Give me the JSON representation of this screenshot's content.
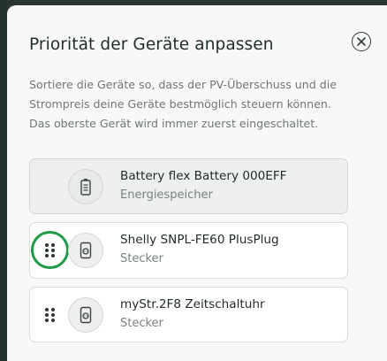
{
  "dialog": {
    "title": "Priorität der Geräte anpassen",
    "description": "Sortiere die Geräte so, dass der PV-Überschuss und die Strompreis deine Geräte bestmöglich steuern können. Das oberste Gerät wird immer zuerst eingeschaltet.",
    "close_icon": "close-circle-icon"
  },
  "devices": [
    {
      "name": "Battery flex Battery 000EFF",
      "type": "Energiespeicher",
      "icon": "battery-icon",
      "draggable": false
    },
    {
      "name": "Shelly SNPL-FE60 PlusPlug",
      "type": "Stecker",
      "icon": "smart-plug-icon",
      "draggable": true,
      "focused": true
    },
    {
      "name": "myStr.2F8 Zeitschaltuhr",
      "type": "Stecker",
      "icon": "smart-plug-icon",
      "draggable": true
    }
  ],
  "colors": {
    "focus_ring": "#1f9a47",
    "title": "#1f2d29",
    "muted_text": "#6f7775",
    "backdrop": "#2e3a34"
  }
}
